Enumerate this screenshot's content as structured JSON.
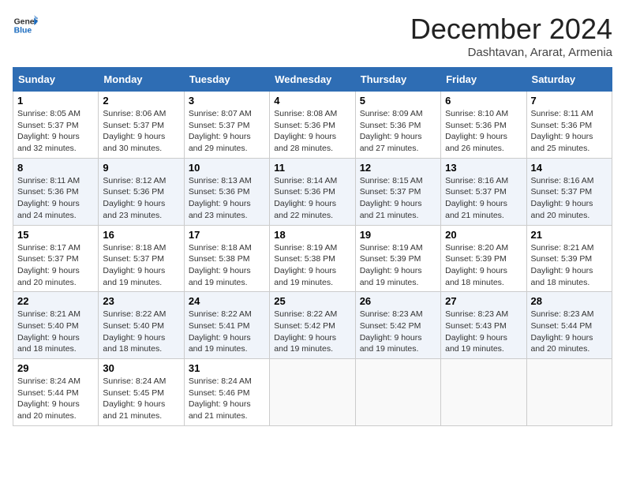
{
  "logo": {
    "general": "General",
    "blue": "Blue"
  },
  "title": "December 2024",
  "location": "Dashtavan, Ararat, Armenia",
  "days_of_week": [
    "Sunday",
    "Monday",
    "Tuesday",
    "Wednesday",
    "Thursday",
    "Friday",
    "Saturday"
  ],
  "weeks": [
    [
      {
        "day": "1",
        "sunrise": "8:05 AM",
        "sunset": "5:37 PM",
        "daylight": "9 hours and 32 minutes."
      },
      {
        "day": "2",
        "sunrise": "8:06 AM",
        "sunset": "5:37 PM",
        "daylight": "9 hours and 30 minutes."
      },
      {
        "day": "3",
        "sunrise": "8:07 AM",
        "sunset": "5:37 PM",
        "daylight": "9 hours and 29 minutes."
      },
      {
        "day": "4",
        "sunrise": "8:08 AM",
        "sunset": "5:36 PM",
        "daylight": "9 hours and 28 minutes."
      },
      {
        "day": "5",
        "sunrise": "8:09 AM",
        "sunset": "5:36 PM",
        "daylight": "9 hours and 27 minutes."
      },
      {
        "day": "6",
        "sunrise": "8:10 AM",
        "sunset": "5:36 PM",
        "daylight": "9 hours and 26 minutes."
      },
      {
        "day": "7",
        "sunrise": "8:11 AM",
        "sunset": "5:36 PM",
        "daylight": "9 hours and 25 minutes."
      }
    ],
    [
      {
        "day": "8",
        "sunrise": "8:11 AM",
        "sunset": "5:36 PM",
        "daylight": "9 hours and 24 minutes."
      },
      {
        "day": "9",
        "sunrise": "8:12 AM",
        "sunset": "5:36 PM",
        "daylight": "9 hours and 23 minutes."
      },
      {
        "day": "10",
        "sunrise": "8:13 AM",
        "sunset": "5:36 PM",
        "daylight": "9 hours and 23 minutes."
      },
      {
        "day": "11",
        "sunrise": "8:14 AM",
        "sunset": "5:36 PM",
        "daylight": "9 hours and 22 minutes."
      },
      {
        "day": "12",
        "sunrise": "8:15 AM",
        "sunset": "5:37 PM",
        "daylight": "9 hours and 21 minutes."
      },
      {
        "day": "13",
        "sunrise": "8:16 AM",
        "sunset": "5:37 PM",
        "daylight": "9 hours and 21 minutes."
      },
      {
        "day": "14",
        "sunrise": "8:16 AM",
        "sunset": "5:37 PM",
        "daylight": "9 hours and 20 minutes."
      }
    ],
    [
      {
        "day": "15",
        "sunrise": "8:17 AM",
        "sunset": "5:37 PM",
        "daylight": "9 hours and 20 minutes."
      },
      {
        "day": "16",
        "sunrise": "8:18 AM",
        "sunset": "5:37 PM",
        "daylight": "9 hours and 19 minutes."
      },
      {
        "day": "17",
        "sunrise": "8:18 AM",
        "sunset": "5:38 PM",
        "daylight": "9 hours and 19 minutes."
      },
      {
        "day": "18",
        "sunrise": "8:19 AM",
        "sunset": "5:38 PM",
        "daylight": "9 hours and 19 minutes."
      },
      {
        "day": "19",
        "sunrise": "8:19 AM",
        "sunset": "5:39 PM",
        "daylight": "9 hours and 19 minutes."
      },
      {
        "day": "20",
        "sunrise": "8:20 AM",
        "sunset": "5:39 PM",
        "daylight": "9 hours and 18 minutes."
      },
      {
        "day": "21",
        "sunrise": "8:21 AM",
        "sunset": "5:39 PM",
        "daylight": "9 hours and 18 minutes."
      }
    ],
    [
      {
        "day": "22",
        "sunrise": "8:21 AM",
        "sunset": "5:40 PM",
        "daylight": "9 hours and 18 minutes."
      },
      {
        "day": "23",
        "sunrise": "8:22 AM",
        "sunset": "5:40 PM",
        "daylight": "9 hours and 18 minutes."
      },
      {
        "day": "24",
        "sunrise": "8:22 AM",
        "sunset": "5:41 PM",
        "daylight": "9 hours and 19 minutes."
      },
      {
        "day": "25",
        "sunrise": "8:22 AM",
        "sunset": "5:42 PM",
        "daylight": "9 hours and 19 minutes."
      },
      {
        "day": "26",
        "sunrise": "8:23 AM",
        "sunset": "5:42 PM",
        "daylight": "9 hours and 19 minutes."
      },
      {
        "day": "27",
        "sunrise": "8:23 AM",
        "sunset": "5:43 PM",
        "daylight": "9 hours and 19 minutes."
      },
      {
        "day": "28",
        "sunrise": "8:23 AM",
        "sunset": "5:44 PM",
        "daylight": "9 hours and 20 minutes."
      }
    ],
    [
      {
        "day": "29",
        "sunrise": "8:24 AM",
        "sunset": "5:44 PM",
        "daylight": "9 hours and 20 minutes."
      },
      {
        "day": "30",
        "sunrise": "8:24 AM",
        "sunset": "5:45 PM",
        "daylight": "9 hours and 21 minutes."
      },
      {
        "day": "31",
        "sunrise": "8:24 AM",
        "sunset": "5:46 PM",
        "daylight": "9 hours and 21 minutes."
      },
      null,
      null,
      null,
      null
    ]
  ],
  "labels": {
    "sunrise": "Sunrise:",
    "sunset": "Sunset:",
    "daylight": "Daylight:"
  }
}
